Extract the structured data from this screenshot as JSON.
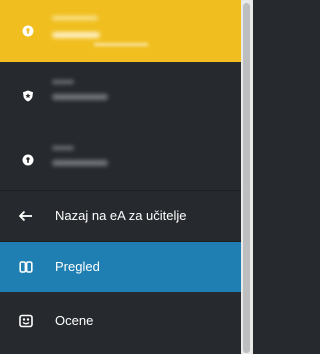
{
  "accounts": [
    {
      "icon": "keyhole-shield-icon",
      "active": true
    },
    {
      "icon": "badge-shield-icon",
      "active": false
    },
    {
      "icon": "keyhole-shield-icon",
      "active": false
    }
  ],
  "nav": {
    "back_label": "Nazaj na eA za učitelje",
    "back_icon": "arrow-left-icon",
    "items": [
      {
        "label": "Pregled",
        "icon": "book-open-icon",
        "active": true
      },
      {
        "label": "Ocene",
        "icon": "grade-card-icon",
        "active": false
      }
    ]
  },
  "colors": {
    "sidebar_bg": "#26292e",
    "account_active_bg": "#f0be1e",
    "item_active_bg": "#1f7fb3",
    "text": "#ffffff"
  }
}
